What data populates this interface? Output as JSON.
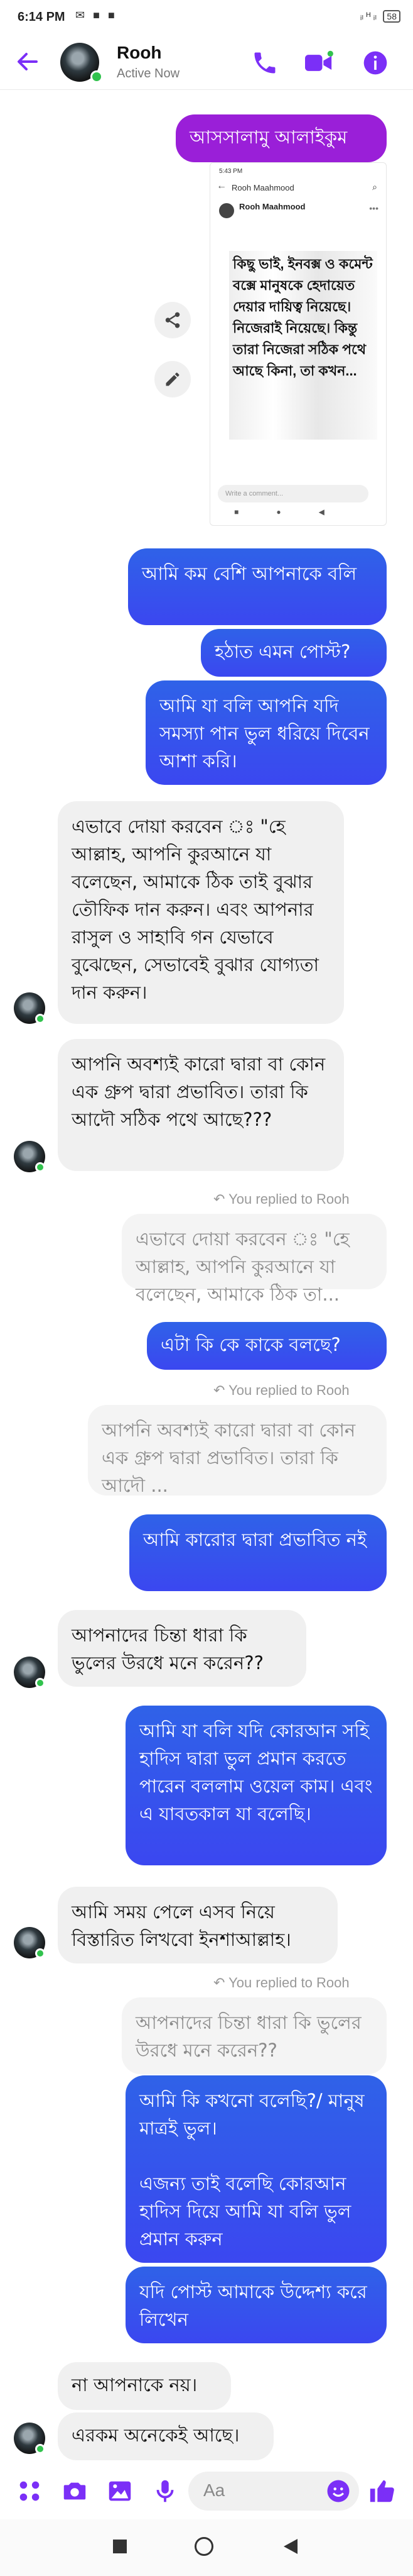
{
  "status_bar": {
    "time": "6:14 PM",
    "notif_icons": "✉ ■ ■",
    "right_info": "ᵢₗ ᴴ ᵢₗ",
    "battery": "58"
  },
  "header": {
    "back_icon": "back-arrow-icon",
    "name": "Rooh",
    "status": "Active Now"
  },
  "screenshot": {
    "time": "5:43 PM",
    "page_name": "Rooh Maahmood",
    "author": "Rooh Maahmood",
    "post_text": "কিছু ভাই, ইনবক্স ও কমেন্ট বক্সে মানুষকে হেদায়েত দেয়ার দায়িত্ব নিয়েছে। নিজেরাই নিয়েছে। কিন্তু তারা নিজেরা সঠিক পথে আছে কিনা, তা কখন...",
    "comment_placeholder": "Write a comment..."
  },
  "messages": [
    {
      "type": "sent-purple",
      "text": "আসসালামু আলাইকুম"
    },
    {
      "type": "sent",
      "text": "আমি কম বেশি আপনাকে বলি"
    },
    {
      "type": "sent",
      "text": "হঠাত এমন পোস্ট?"
    },
    {
      "type": "sent",
      "text": "আমি যা বলি আপনি যদি সমস্যা পান ভুল ধরিয়ে দিবেন আশা করি।"
    },
    {
      "type": "received",
      "text": "এভাবে দোয়া করবেন ঃ \"হে আল্লাহ, আপনি কুরআনে যা বলেছেন, আমাকে ঠিক তাই বুঝার তৌফিক দান করুন। এবং আপনার রাসুল ও সাহাবি গন যেভাবে বুঝেছেন, সেভাবেই বুঝার যোগ্যতা দান করুন।"
    },
    {
      "type": "received",
      "text": "আপনি অবশ্যই কারো দ্বারা বা কোন এক গ্রুপ দ্বারা প্রভাবিত। তারা কি আদৌ সঠিক পথে আছে???"
    },
    {
      "type": "replied",
      "text": "You replied to Rooh"
    },
    {
      "type": "quote",
      "text": "এভাবে দোয়া করবেন ঃ \"হে আল্লাহ, আপনি কুরআনে যা বলেছেন, আমাকে ঠিক তা..."
    },
    {
      "type": "sent",
      "text": "এটা কি কে কাকে বলছে?"
    },
    {
      "type": "replied",
      "text": "You replied to Rooh"
    },
    {
      "type": "quote",
      "text": "আপনি অবশ্যই কারো দ্বারা বা কোন এক গ্রুপ দ্বারা প্রভাবিত। তারা কি আদৌ ..."
    },
    {
      "type": "sent",
      "text": "আমি কারোর দ্বারা প্রভাবিত নই"
    },
    {
      "type": "received",
      "text": "আপনাদের চিন্তা ধারা কি ভুলের উরধে মনে করেন??"
    },
    {
      "type": "sent",
      "text": "আমি যা বলি যদি কোরআন সহি হাদিস দ্বারা ভুল প্রমান করতে পারেন বললাম ওয়েল কাম। এবং এ যাবতকাল যা বলেছি।"
    },
    {
      "type": "received",
      "text": "আমি সময় পেলে এসব নিয়ে বিস্তারিত লিখবো ইনশাআল্লাহ।"
    },
    {
      "type": "replied",
      "text": "You replied to Rooh"
    },
    {
      "type": "quote",
      "text": "আপনাদের চিন্তা ধারা কি ভুলের উরধে মনে করেন??"
    },
    {
      "type": "sent",
      "text": "আমি কি কখনো বলেছি?/ মানুষ মাত্রই ভুল।\n\nএজন্য তাই বলেছি কোরআন হাদিস দিয়ে আমি যা বলি ভুল প্রমান করুন"
    },
    {
      "type": "sent",
      "text": "যদি পোস্ট আমাকে উদ্দেশ্য করে লিখেন"
    },
    {
      "type": "received",
      "text": "না আপনাকে নয়।"
    },
    {
      "type": "received",
      "text": "এরকম অনেকেই আছে।"
    }
  ],
  "composer": {
    "placeholder": "Aa"
  },
  "colors": {
    "accent": "#7b2ff7",
    "sent_bubble": "#3b4ef0",
    "greeting_bubble": "#9a1fd8",
    "received_bubble": "#f0f0f0"
  }
}
